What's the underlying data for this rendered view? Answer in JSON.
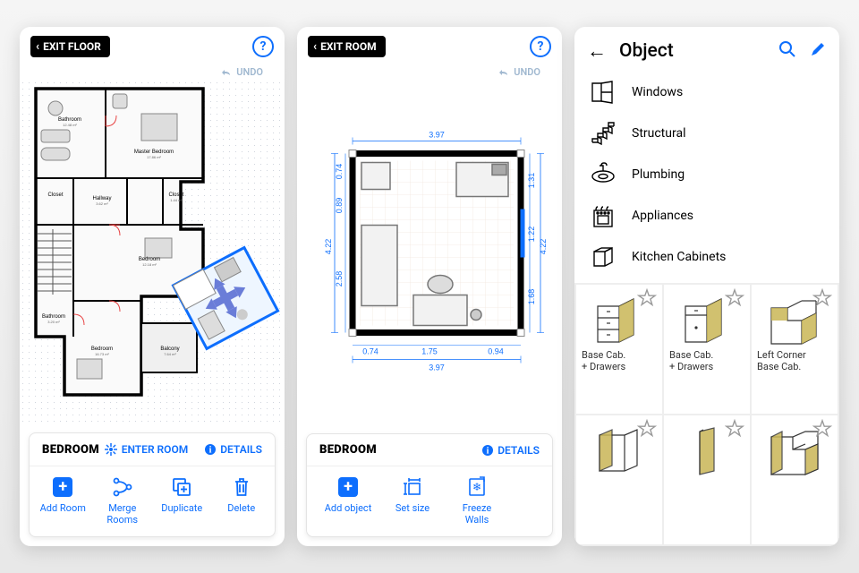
{
  "screens": {
    "floor": {
      "exit_label": "EXIT FLOOR",
      "undo_label": "UNDO",
      "rooms": {
        "master_bedroom": {
          "name": "Master Bedroom",
          "area": "17.86 m²"
        },
        "bathroom1": {
          "name": "Bathroom",
          "area": "12.48 m²"
        },
        "hallway": {
          "name": "Hallway",
          "area": "3.62 m²"
        },
        "closet1": {
          "name": "Closet"
        },
        "closet2": {
          "name": "Closet",
          "area": "1.44 m²"
        },
        "bedroom1": {
          "name": "Bedroom",
          "area": "12.18 m²"
        },
        "bathroom2": {
          "name": "Bathroom",
          "area": "3.20 m²"
        },
        "balcony": {
          "name": "Balcony",
          "area": "7.64 m²"
        },
        "bedroom2": {
          "name": "Bedroom",
          "area": "16.73 m²"
        }
      },
      "panel": {
        "title": "BEDROOM",
        "enter_room": "ENTER ROOM",
        "details": "DETAILS",
        "add_room": "Add Room",
        "merge_rooms": "Merge\nRooms",
        "duplicate": "Duplicate",
        "delete": "Delete"
      }
    },
    "room": {
      "exit_label": "EXIT ROOM",
      "undo_label": "UNDO",
      "dimensions": {
        "top_width": "3.97",
        "bottom_width": "3.97",
        "left_height": "4.22",
        "right_height": "4.22",
        "right_seg1": "1.31",
        "right_seg2": "1.22",
        "right_seg3": "1.68",
        "left_seg1": "0.74",
        "left_seg2": "0.89",
        "left_seg3": "2.58",
        "bottom_seg1": "0.74",
        "bottom_seg2": "1.75",
        "bottom_seg3": "0.94"
      },
      "panel": {
        "title": "BEDROOM",
        "details": "DETAILS",
        "add_object": "Add object",
        "set_size": "Set size",
        "freeze_walls": "Freeze\nWalls"
      }
    },
    "object": {
      "title": "Object",
      "categories": [
        {
          "name": "Windows"
        },
        {
          "name": "Structural"
        },
        {
          "name": "Plumbing"
        },
        {
          "name": "Appliances"
        },
        {
          "name": "Kitchen Cabinets"
        }
      ],
      "tiles": [
        {
          "label": "Base Cab.\n+ Drawers"
        },
        {
          "label": "Base Cab.\n+ Drawers"
        },
        {
          "label": "Left Corner\nBase Cab."
        },
        {
          "label": ""
        },
        {
          "label": ""
        },
        {
          "label": ""
        }
      ]
    }
  }
}
